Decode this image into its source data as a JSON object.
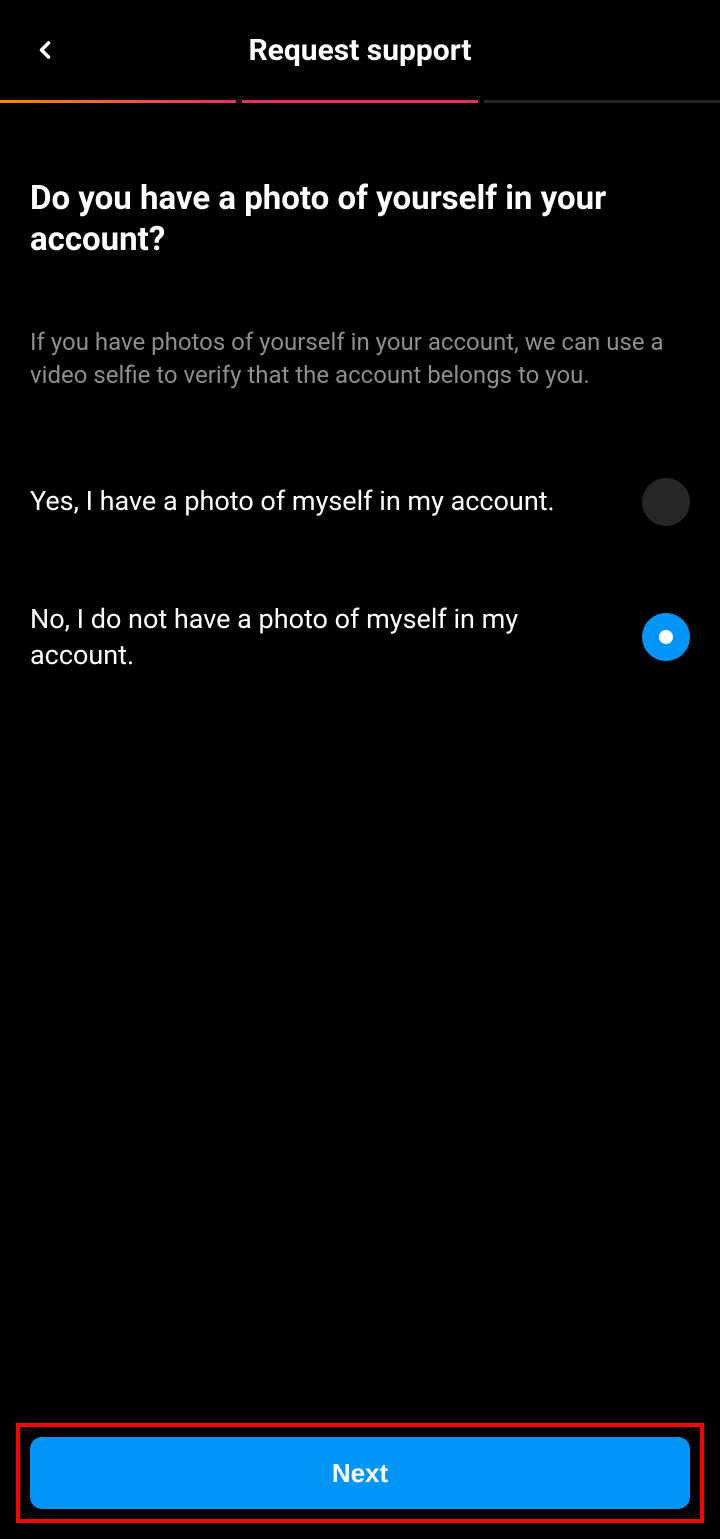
{
  "header": {
    "title": "Request support"
  },
  "question": {
    "title": "Do you have a photo of yourself in your account?",
    "subtitle": "If you have photos of yourself in your account, we can use a video selfie to verify that the account belongs to you."
  },
  "options": [
    {
      "label": "Yes, I have a photo of myself in my account.",
      "selected": false
    },
    {
      "label": "No, I do not have a photo of myself in my account.",
      "selected": true
    }
  ],
  "footer": {
    "next_label": "Next"
  }
}
